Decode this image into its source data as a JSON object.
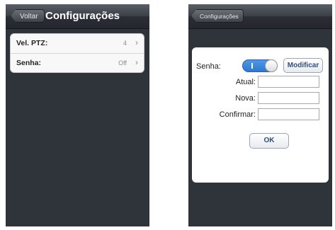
{
  "left_screen": {
    "nav": {
      "back_label": "Voltar",
      "title": "Configurações"
    },
    "rows": [
      {
        "label": "Vel. PTZ:",
        "value": "4"
      },
      {
        "label": "Senha:",
        "value": "Off"
      }
    ],
    "chevron_icon": "chevron-right-icon"
  },
  "right_screen": {
    "nav": {
      "back_label": "Configurações"
    },
    "senha": {
      "label": "Senha:",
      "toggle_text": "I",
      "toggle_state": "on",
      "modify_label": "Modificar"
    },
    "fields": [
      {
        "label": "Atual:",
        "value": "",
        "placeholder": ""
      },
      {
        "label": "Nova:",
        "value": "",
        "placeholder": ""
      },
      {
        "label": "Confirmar:",
        "value": "",
        "placeholder": ""
      }
    ],
    "ok_label": "OK"
  },
  "colors": {
    "toggle_on": "#2f78cf",
    "background_dark": "#2f333a",
    "button_text": "#2f4f7a"
  }
}
